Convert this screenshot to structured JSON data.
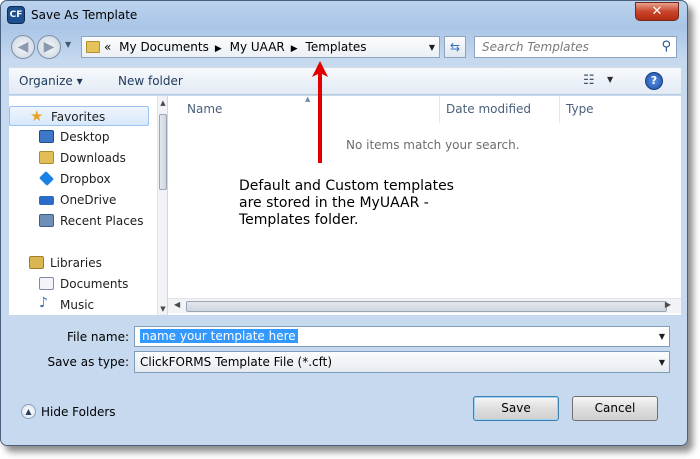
{
  "window": {
    "title": "Save As Template",
    "close_glyph": "✕",
    "app_icon": "clickforms-app-icon",
    "app_icon_text": "CF"
  },
  "address": {
    "crumbs": [
      "«",
      "My Documents",
      "My UAAR",
      "Templates"
    ],
    "separator_glyph": "▶",
    "search_placeholder": "Search Templates"
  },
  "toolbar": {
    "organize_label": "Organize ▾",
    "new_folder_label": "New folder",
    "view_glyph": "☷",
    "help_glyph": "?"
  },
  "nav": {
    "favorites": "Favorites",
    "items": [
      "Desktop",
      "Downloads",
      "Dropbox",
      "OneDrive",
      "Recent Places"
    ],
    "libraries": "Libraries",
    "library_items": [
      "Documents",
      "Music"
    ]
  },
  "files": {
    "columns": [
      "Name",
      "Date modified",
      "Type"
    ],
    "empty_message": "No items match your search."
  },
  "annotation": {
    "text_lines": [
      "Default and Custom templates",
      "are stored in the MyUAAR -",
      "Templates folder."
    ],
    "arrow_color": "#e00000"
  },
  "form": {
    "file_name_label": "File name:",
    "file_name_value": "name your template here",
    "save_type_label": "Save as type:",
    "save_type_value": "ClickFORMS Template File (*.cft)"
  },
  "footer": {
    "hide_folders_label": "Hide Folders",
    "save_label": "Save",
    "cancel_label": "Cancel"
  },
  "colors": {
    "selection": "#3399ff",
    "link_text": "#1e395b",
    "frame": "#a9c5e6"
  }
}
